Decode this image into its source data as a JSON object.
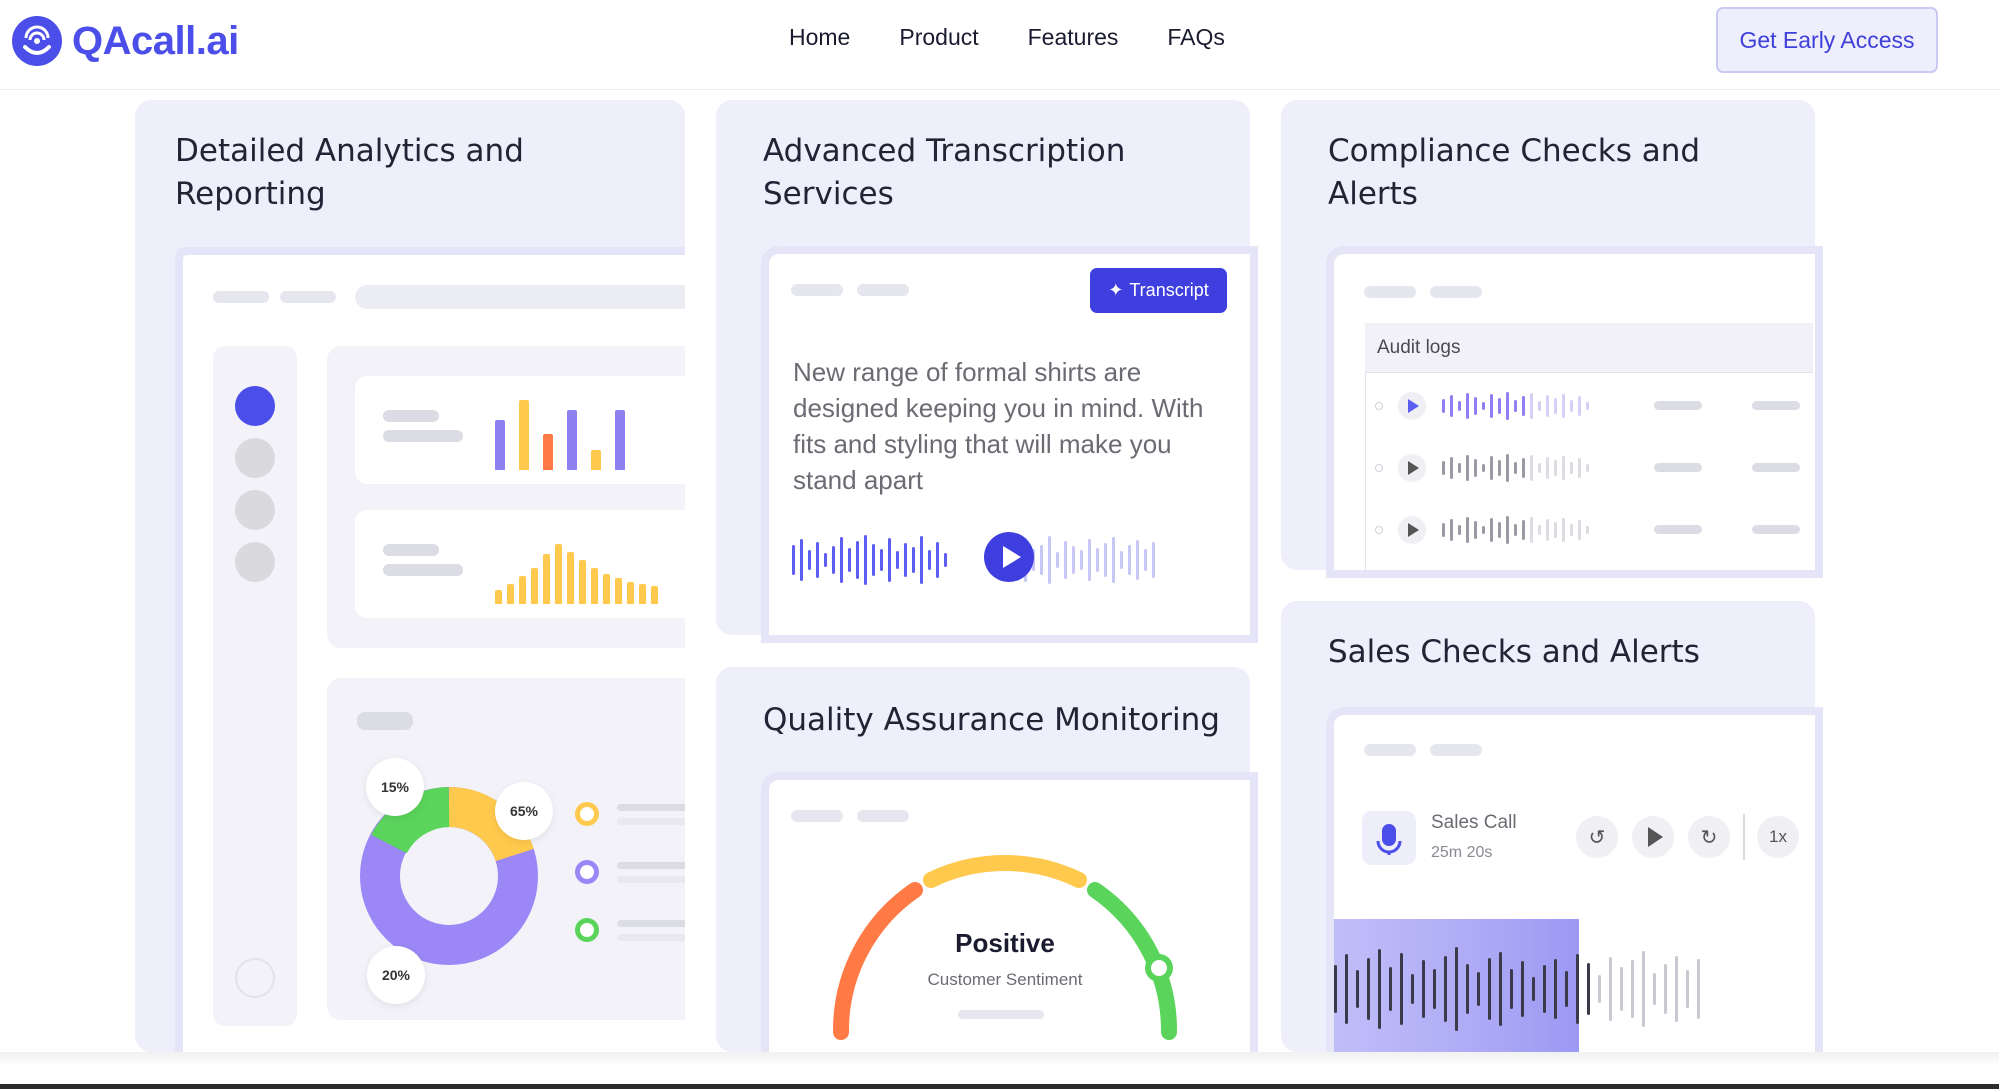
{
  "brand": {
    "name": "QAcall.ai"
  },
  "nav": {
    "items": [
      "Home",
      "Product",
      "Features",
      "FAQs"
    ],
    "cta": "Get Early Access"
  },
  "cards": {
    "analytics": {
      "title_line1": "Detailed Analytics and",
      "title_line2": "Reporting",
      "donut": {
        "segments": [
          {
            "label": "15%",
            "value": 15,
            "color": "#5bd45b"
          },
          {
            "label": "65%",
            "value": 65,
            "color": "#9b87f5"
          },
          {
            "label": "20%",
            "value": 20,
            "color": "#ffc94d"
          }
        ]
      }
    },
    "transcription": {
      "title_line1": "Advanced Transcription",
      "title_line2": "Services",
      "button": "Transcript",
      "text": "New range of formal shirts are designed keeping you in mind. With fits and styling that will make you stand apart"
    },
    "compliance": {
      "title_line1": "Compliance Checks and",
      "title_line2": "Alerts",
      "audit_label": "Audit logs"
    },
    "qa": {
      "title": "Quality Assurance Monitoring",
      "gauge_value": "Positive",
      "gauge_label": "Customer Sentiment"
    },
    "sales": {
      "title": "Sales Checks and Alerts",
      "call_title": "Sales Call",
      "call_duration": "25m 20s",
      "speed": "1x"
    }
  },
  "colors": {
    "accent": "#4b4ee8",
    "card_bg": "#efeefb",
    "yellow": "#ffc94d",
    "orange": "#ff7a45",
    "green": "#5bd45b"
  }
}
